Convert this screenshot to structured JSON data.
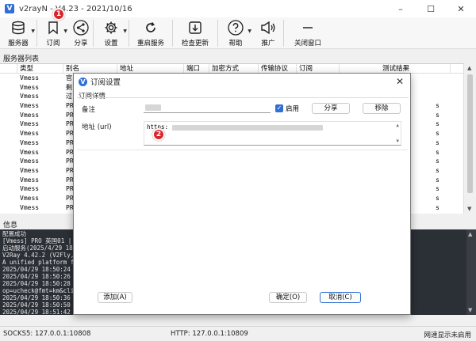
{
  "window": {
    "title": "v2rayN - V4.23 - 2021/10/16",
    "icon": "V",
    "controls": [
      "–",
      "☐",
      "✕"
    ]
  },
  "toolbar": {
    "servers": "服务器",
    "subscription": "订阅",
    "share": "分享",
    "settings": "设置",
    "restart": "重启服务",
    "check_update": "检查更新",
    "help": "帮助",
    "promotion": "推广",
    "close_window": "关闭窗口"
  },
  "badges": {
    "one": "1",
    "two": "2"
  },
  "server_list": {
    "label": "服务器列表",
    "columns": [
      "类型",
      "别名",
      "地址",
      "端口",
      "加密方式",
      "传输协议",
      "订阅",
      "测试结果"
    ],
    "rows": [
      [
        "Vmess",
        "官"
      ],
      [
        "Vmess",
        "剩"
      ],
      [
        "Vmess",
        "过"
      ],
      [
        "Vmess",
        "PR",
        "s"
      ],
      [
        "Vmess",
        "PR",
        "s"
      ],
      [
        "Vmess",
        "PR",
        "s"
      ],
      [
        "Vmess",
        "PR",
        "s"
      ],
      [
        "Vmess",
        "PR",
        "s"
      ],
      [
        "Vmess",
        "PR",
        "s"
      ],
      [
        "Vmess",
        "PR",
        "s"
      ],
      [
        "Vmess",
        "PR",
        "s"
      ],
      [
        "Vmess",
        "PR",
        "s"
      ],
      [
        "Vmess",
        "PR",
        "s"
      ],
      [
        "Vmess",
        "PR",
        "s"
      ],
      [
        "Vmess",
        "PR",
        "s"
      ]
    ]
  },
  "info": {
    "label": "信息",
    "lines": [
      "配置成功",
      "[Vmess] PRO 英国01 | 2",
      "启动服务(2025/4/29 18",
      "V2Ray 4.42.2 (V2Fly,",
      "A unified platform fo",
      "2025/04/29 18:50:24 [",
      "2025/04/29 18:50:26 [",
      "2025/04/29 18:50:28 [",
      "op=ucheck@fmt=km&clie",
      "2025/04/29 18:50:36 [",
      "2025/04/29 18:50:50 [",
      "2025/04/29 18:51:42 ["
    ]
  },
  "statusbar": {
    "socks": "SOCKS5:  127.0.0.1:10808",
    "http": "HTTP:  127.0.0.1:10809",
    "speed": "网速显示未启用"
  },
  "dialog": {
    "title": "订阅设置",
    "icon": "V",
    "group_title": "订阅详情",
    "remark_label": "备注",
    "enable_label": "启用",
    "share_button": "分享",
    "remove_button": "移除",
    "url_label": "地址 (url)",
    "url_value": "https:",
    "add_button": "添加(A)",
    "ok_button": "确定(O)",
    "cancel_button": "取消(C)",
    "close": "✕"
  },
  "colors": {
    "accent": "#2f6fd6",
    "badge": "#d8262a",
    "log_bg": "#2b2f36"
  }
}
